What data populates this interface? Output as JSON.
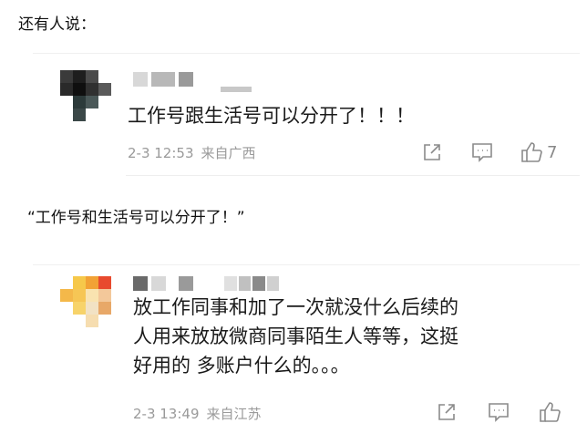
{
  "intro_text": "还有人说：",
  "quote_text": "“工作号和生活号可以分开了！”",
  "comments": [
    {
      "content": "工作号跟生活号可以分开了！！！",
      "time": "2-3 12:53",
      "source": "来自广西",
      "likes": "7"
    },
    {
      "content_lines": [
        "放工作同事和加了一次就没什么后续的",
        "人用来放放微商同事陌生人等等，这挺",
        "好用的 多账户什么的。。。"
      ],
      "time": "2-3 13:49",
      "source": "来自江苏",
      "likes": ""
    }
  ],
  "icons": {
    "share": "share-icon",
    "comment": "comment-icon",
    "like": "thumbs-up-icon"
  },
  "colors": {
    "meta_text": "#9a9a9a",
    "icon": "#888888",
    "content_text": "#1a1a1a"
  }
}
